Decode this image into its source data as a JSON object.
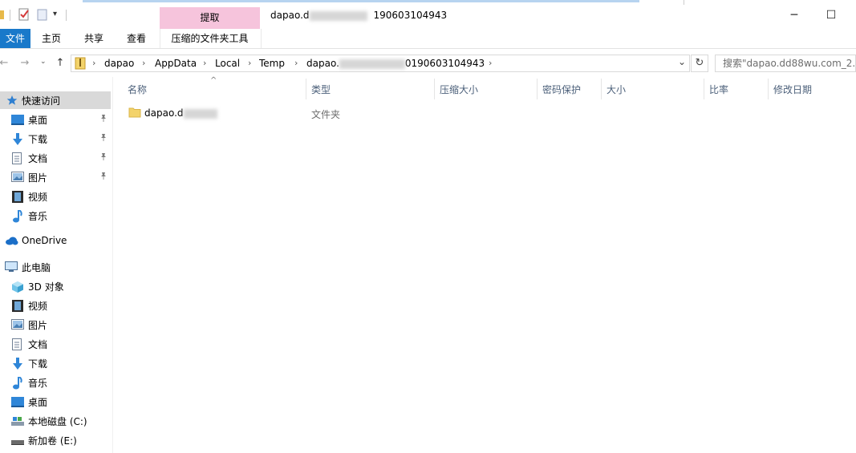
{
  "window": {
    "title_prefix": "dapao.d",
    "title_suffix": "190603104943",
    "minimize": "─",
    "maximize": "☐",
    "context_tab": "提取",
    "context_tab_group": "压缩的文件夹工具"
  },
  "ribbon": {
    "tabs": [
      "文件",
      "主页",
      "共享",
      "查看"
    ]
  },
  "address": {
    "back": "←",
    "forward": "→",
    "up": "↑",
    "crumbs": [
      "dapao",
      "AppData",
      "Local",
      "Temp",
      "dapao."
    ],
    "last_crumb_suffix": "0190603104943",
    "separator": "›",
    "dropdown": "⌄",
    "refresh": "↻",
    "search_placeholder": "搜索\"dapao.dd88wu.com_2..."
  },
  "nav": {
    "quick_access": "快速访问",
    "quick_items": [
      "桌面",
      "下载",
      "文档",
      "图片",
      "视频",
      "音乐"
    ],
    "onedrive": "OneDrive",
    "this_pc": "此电脑",
    "pc_items": [
      "3D 对象",
      "视频",
      "图片",
      "文档",
      "下载",
      "音乐",
      "桌面",
      "本地磁盘 (C:)",
      "新加卷 (E:)"
    ],
    "pin_glyph": "📌"
  },
  "columns": {
    "sort_glyph": "^",
    "headers": [
      "名称",
      "类型",
      "压缩大小",
      "密码保护",
      "大小",
      "比率",
      "修改日期"
    ]
  },
  "files": [
    {
      "name_prefix": "dapao.d",
      "type": "文件夹"
    }
  ],
  "colors": {
    "accent": "#1979ca",
    "context_tab": "#f6c4dc",
    "selected_nav": "#d9d9d9",
    "header_text": "#4c607a"
  }
}
